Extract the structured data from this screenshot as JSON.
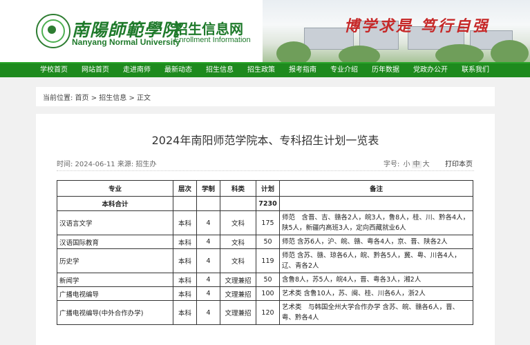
{
  "header": {
    "school_cn": "南陽師範學院",
    "school_en": "Nanyang Normal University",
    "site_cn": "招生信息网",
    "site_en": "Enrollment Information",
    "motto": "博学求是 笃行自强"
  },
  "nav": [
    "学校首页",
    "网站首页",
    "走进南师",
    "最新动态",
    "招生信息",
    "招生政策",
    "报考指南",
    "专业介绍",
    "历年数据",
    "党政办公开",
    "联系我们"
  ],
  "breadcrumb": "当前位置: 首页 > 招生信息 > 正文",
  "article": {
    "title": "2024年南阳师范学院本、专科招生计划一览表",
    "meta": "时间: 2024-06-11  来源: 招生办",
    "fontsize_label": "字号:",
    "size_small": "小",
    "size_mid": "中",
    "size_large": "大",
    "print": "打印本页"
  },
  "table": {
    "headers": [
      "专业",
      "层次",
      "学制",
      "科类",
      "计划",
      "备注"
    ],
    "total": {
      "label": "本科合计",
      "plan": "7230"
    },
    "rows": [
      {
        "major": "汉语言文学",
        "level": "本科",
        "years": "4",
        "type": "文科",
        "plan": "175",
        "note": "师范　含晋、吉、赣各2人，皖3人，鲁8人，桂、川、黔各4人，陕5人，新疆内高班3人，定向西藏就业6人"
      },
      {
        "major": "汉语国际教育",
        "level": "本科",
        "years": "4",
        "type": "文科",
        "plan": "50",
        "note": "师范 含苏6人，沪、皖、赣、粤各4人，京、晋、陕各2人"
      },
      {
        "major": "历史学",
        "level": "本科",
        "years": "4",
        "type": "文科",
        "plan": "119",
        "note": "师范 含苏、赣、琼各6人，皖、黔各5人，冀、粤、川各4人，辽、青各2人"
      },
      {
        "major": "新闻学",
        "level": "本科",
        "years": "4",
        "type": "文理兼招",
        "plan": "50",
        "note": "含鲁8人，苏5人，皖4人，晋、粤各3人，湘2人"
      },
      {
        "major": "广播电视编导",
        "level": "本科",
        "years": "4",
        "type": "文理兼招",
        "plan": "100",
        "note": "艺术类 含鲁10人，苏、闽、桂、川各6人，浙2人"
      },
      {
        "major": "广播电视编导(中外合作办学)",
        "level": "本科",
        "years": "4",
        "type": "文理兼招",
        "plan": "120",
        "note": "艺术类　与韩国全州大学合作办学 含苏、皖、赣各6人，晋、粤、黔各4人"
      }
    ]
  }
}
